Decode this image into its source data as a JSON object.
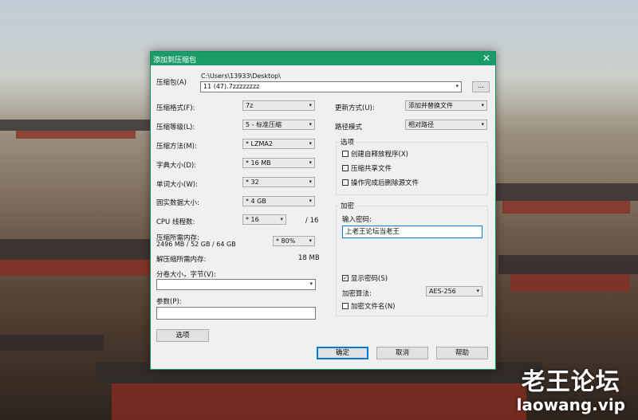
{
  "window": {
    "title": "添加到压缩包",
    "close_glyph": "✕"
  },
  "archive": {
    "label": "压缩包(A)",
    "path_prefix": "C:\\Users\\13933\\Desktop\\",
    "filename": "11 (47).7zzzzzzzz",
    "browse_label": "..."
  },
  "left": {
    "format": {
      "label": "压缩格式(F):",
      "value": "7z"
    },
    "level": {
      "label": "压缩等级(L):",
      "value": "5 - 标准压缩"
    },
    "method": {
      "label": "压缩方法(M):",
      "value": "* LZMA2"
    },
    "dict": {
      "label": "字典大小(D):",
      "value": "* 16 MB"
    },
    "word": {
      "label": "单词大小(W):",
      "value": "* 32"
    },
    "solid": {
      "label": "固实数据大小:",
      "value": "* 4 GB"
    },
    "threads": {
      "label": "CPU 线程数:",
      "value": "* 16",
      "total": "/ 16"
    },
    "memory": {
      "label": "压缩所需内存:",
      "detail": "2496 MB / 52 GB / 64 GB",
      "percent": "* 80%"
    },
    "decompress": {
      "label": "解压缩所需内存:",
      "value": "18 MB"
    },
    "split": {
      "label": "分卷大小，字节(V):",
      "value": ""
    },
    "params": {
      "label": "参数(P):",
      "value": ""
    },
    "options_button": "选项"
  },
  "right": {
    "update": {
      "label": "更新方式(U):",
      "value": "添加并替换文件"
    },
    "pathmode": {
      "label": "路径模式",
      "value": "相对路径"
    },
    "options_group": {
      "title": "选项",
      "items": [
        {
          "label": "创建自释放程序(X)",
          "checked": false
        },
        {
          "label": "压缩共享文件",
          "checked": false
        },
        {
          "label": "操作完成后删除源文件",
          "checked": false
        }
      ]
    },
    "encrypt_group": {
      "title": "加密",
      "password_label": "输入密码:",
      "password_value": "上老王论坛当老王",
      "show_password": {
        "label": "显示密码(S)",
        "checked": true
      },
      "algorithm": {
        "label": "加密算法:",
        "value": "AES-256"
      },
      "encrypt_names": {
        "label": "加密文件名(N)",
        "checked": false
      }
    }
  },
  "buttons": {
    "ok": "确定",
    "cancel": "取消",
    "help": "帮助"
  },
  "watermark": {
    "line1": "老王论坛",
    "line2": "laowang.vip"
  }
}
